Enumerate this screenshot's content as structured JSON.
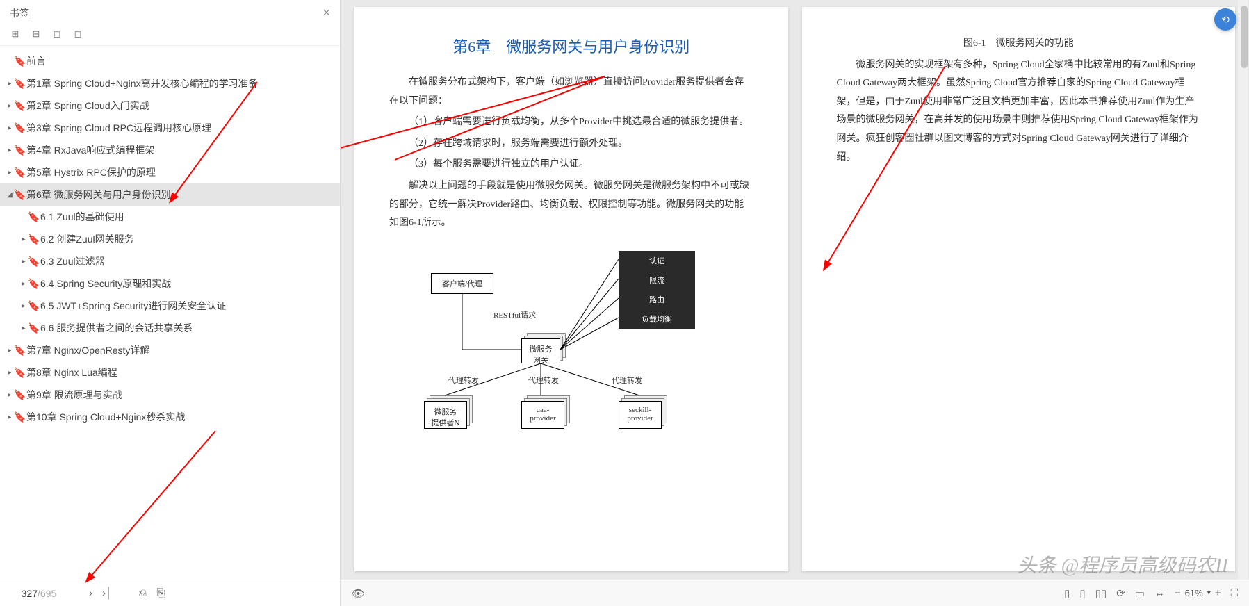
{
  "sidebar": {
    "title": "书签",
    "items": [
      {
        "caret": "",
        "label": "前言",
        "indent": 0,
        "selected": false
      },
      {
        "caret": "▸",
        "label": "第1章 Spring Cloud+Nginx高并发核心编程的学习准备",
        "indent": 0,
        "selected": false
      },
      {
        "caret": "▸",
        "label": "第2章 Spring Cloud入门实战",
        "indent": 0,
        "selected": false
      },
      {
        "caret": "▸",
        "label": "第3章 Spring Cloud RPC远程调用核心原理",
        "indent": 0,
        "selected": false
      },
      {
        "caret": "▸",
        "label": "第4章 RxJava响应式编程框架",
        "indent": 0,
        "selected": false
      },
      {
        "caret": "▸",
        "label": "第5章 Hystrix RPC保护的原理",
        "indent": 0,
        "selected": false
      },
      {
        "caret": "◢",
        "label": "第6章 微服务网关与用户身份识别",
        "indent": 0,
        "selected": true
      },
      {
        "caret": "",
        "label": "6.1 Zuul的基础使用",
        "indent": 1,
        "selected": false
      },
      {
        "caret": "▸",
        "label": "6.2 创建Zuul网关服务",
        "indent": 1,
        "selected": false
      },
      {
        "caret": "▸",
        "label": "6.3 Zuul过滤器",
        "indent": 1,
        "selected": false
      },
      {
        "caret": "▸",
        "label": "6.4 Spring Security原理和实战",
        "indent": 1,
        "selected": false
      },
      {
        "caret": "▸",
        "label": "6.5 JWT+Spring Security进行网关安全认证",
        "indent": 1,
        "selected": false
      },
      {
        "caret": "▸",
        "label": "6.6 服务提供者之间的会话共享关系",
        "indent": 1,
        "selected": false
      },
      {
        "caret": "▸",
        "label": "第7章 Nginx/OpenResty详解",
        "indent": 0,
        "selected": false
      },
      {
        "caret": "▸",
        "label": "第8章 Nginx Lua编程",
        "indent": 0,
        "selected": false
      },
      {
        "caret": "▸",
        "label": "第9章 限流原理与实战",
        "indent": 0,
        "selected": false
      },
      {
        "caret": "▸",
        "label": "第10章 Spring Cloud+Nginx秒杀实战",
        "indent": 0,
        "selected": false
      }
    ]
  },
  "pager": {
    "current": "327",
    "total": "/695"
  },
  "page_left": {
    "title": "第6章　微服务网关与用户身份识别",
    "p1": "在微服务分布式架构下，客户端（如浏览器）直接访问Provider服务提供者会存在以下问题：",
    "p2": "（1）客户端需要进行负载均衡，从多个Provider中挑选最合适的微服务提供者。",
    "p3": "（2）存在跨域请求时，服务端需要进行额外处理。",
    "p4": "（3）每个服务需要进行独立的用户认证。",
    "p5": "解决以上问题的手段就是使用微服务网关。微服务网关是微服务架构中不可或缺的部分，它统一解决Provider路由、均衡负载、权限控制等功能。微服务网关的功能如图6-1所示。",
    "diagram": {
      "client": "客户端/代理",
      "restful": "RESTful请求",
      "gateway": "微服务\n网关",
      "auth": "认证",
      "limit": "限流",
      "route": "路由",
      "lb": "负载均衡",
      "fwd": "代理转发",
      "svc1": "微服务\n提供者N",
      "svc2": "uaa-\nprovider",
      "svc3": "seckill-\nprovider"
    }
  },
  "page_right": {
    "caption": "图6-1　微服务网关的功能",
    "p1": "微服务网关的实现框架有多种，Spring Cloud全家桶中比较常用的有Zuul和Spring Cloud Gateway两大框架。虽然Spring Cloud官方推荐自家的Spring Cloud Gateway框架，但是，由于Zuul使用非常广泛且文档更加丰富，因此本书推荐使用Zuul作为生产场景的微服务网关，在高并发的使用场景中则推荐使用Spring Cloud Gateway框架作为网关。疯狂创客圈社群以图文博客的方式对Spring Cloud Gateway网关进行了详细介绍。"
  },
  "statusbar": {
    "zoom": "61%"
  },
  "watermark": "头条 @程序员高级码农II"
}
